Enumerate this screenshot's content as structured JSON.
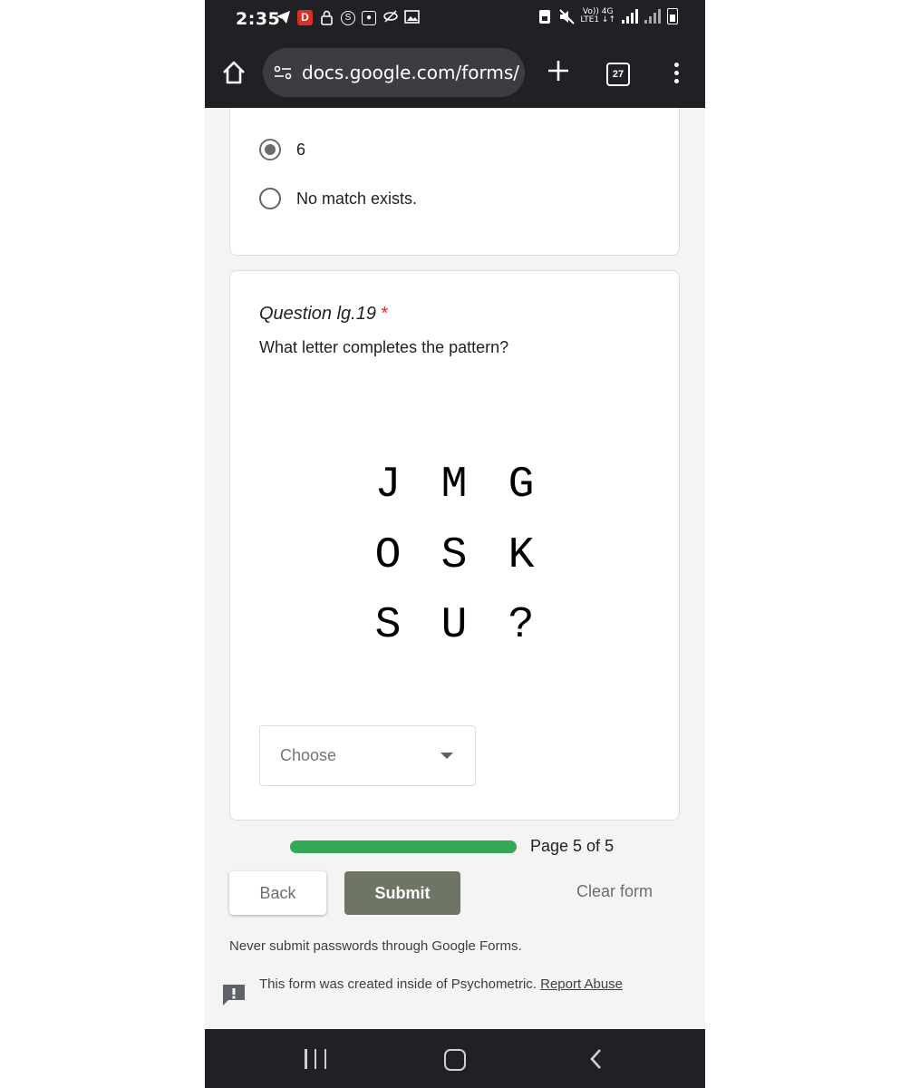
{
  "status_bar": {
    "time": "2:35",
    "network_label_top": "Vo)) 4G",
    "network_label_bottom": "LTE1 ↓↑",
    "icons_left": [
      "telegram-icon",
      "app-d-icon",
      "lock-icon",
      "s-circle-icon",
      "camera-icon",
      "no-eye-icon",
      "image-icon"
    ],
    "icons_right": [
      "lock-badge-icon",
      "mute-icon",
      "signal-icon",
      "signal-icon-2",
      "battery-icon"
    ]
  },
  "browser": {
    "url": "docs.google.com/forms/d",
    "tab_count": "27"
  },
  "prev_question": {
    "options": [
      {
        "label": "6",
        "checked": true
      },
      {
        "label": "No match exists.",
        "checked": false
      }
    ]
  },
  "question": {
    "title": "Question lg.19",
    "required_mark": "*",
    "text": "What letter completes the pattern?",
    "grid": [
      [
        "J",
        "M",
        "G"
      ],
      [
        "O",
        "S",
        "K"
      ],
      [
        "S",
        "U",
        "?"
      ]
    ],
    "dropdown_placeholder": "Choose"
  },
  "progress": {
    "fraction": 1.0,
    "label": "Page 5 of 5",
    "color": "#34a853"
  },
  "actions": {
    "back": "Back",
    "submit": "Submit",
    "clear": "Clear form"
  },
  "footer": {
    "password_note": "Never submit passwords through Google Forms.",
    "created_note": "This form was created inside of Psychometric.",
    "report_link": "Report Abuse"
  }
}
